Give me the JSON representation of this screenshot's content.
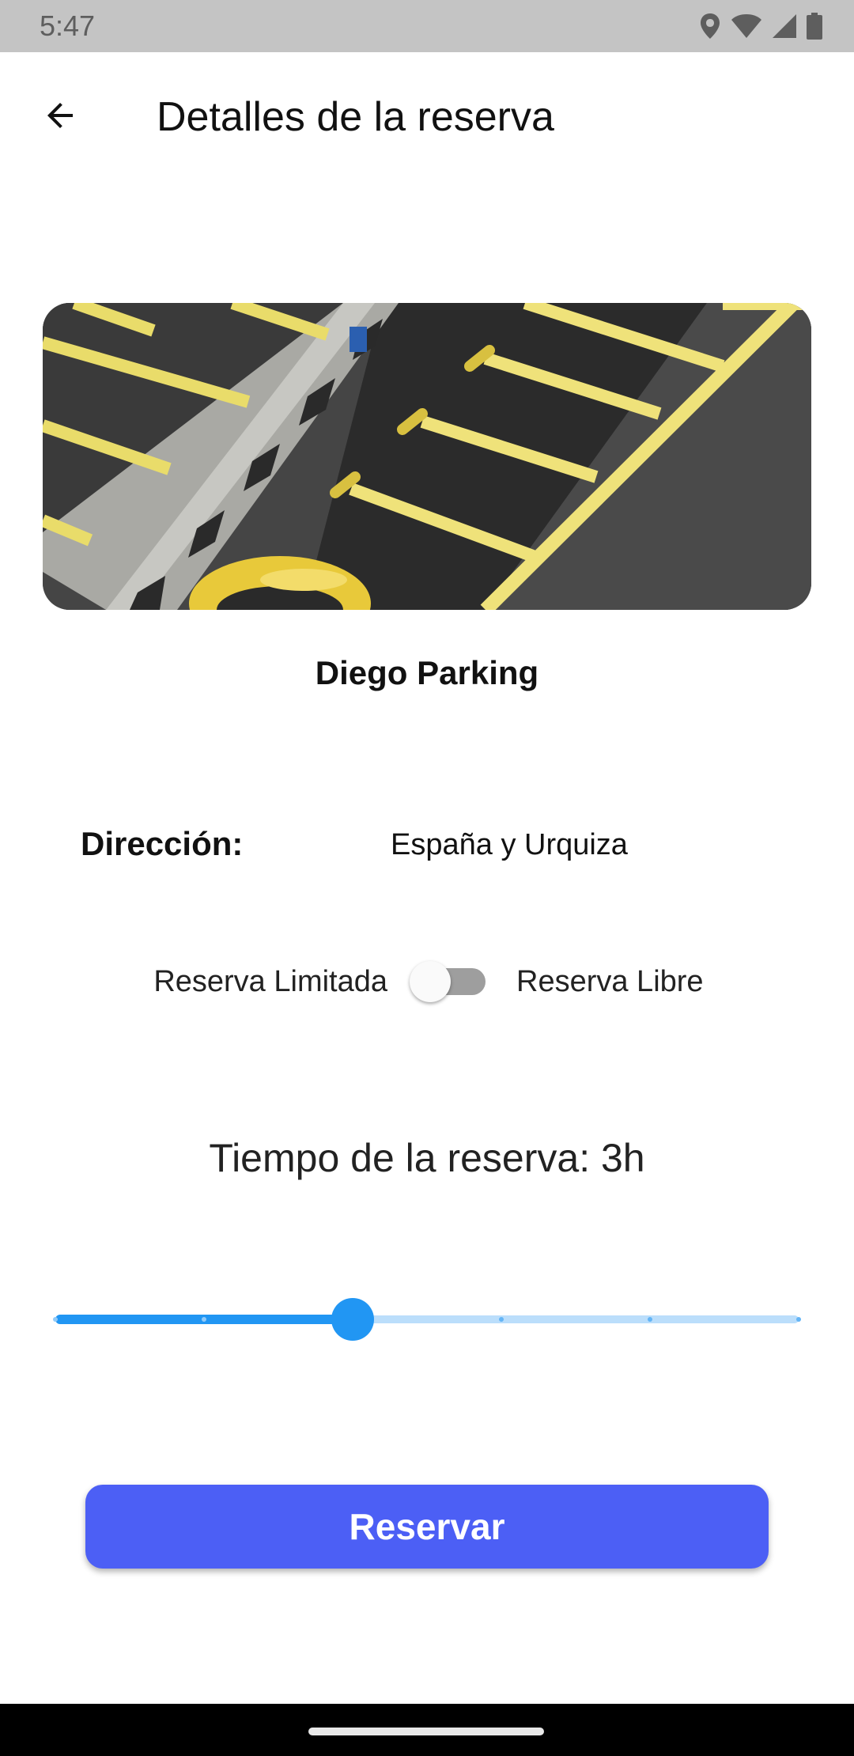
{
  "status_bar": {
    "time": "5:47",
    "icons": [
      "location-icon",
      "wifi-icon",
      "cellular-signal-icon",
      "battery-icon"
    ]
  },
  "app_bar": {
    "back_icon": "arrow-left-icon",
    "title": "Detalles de la reserva"
  },
  "parking": {
    "image": "parking-lot-photo",
    "name": "Diego Parking",
    "address_label": "Dirección:",
    "address_value": "España y Urquiza"
  },
  "reservation_type": {
    "left_label": "Reserva Limitada",
    "right_label": "Reserva Libre",
    "is_on": false
  },
  "duration": {
    "label": "Tiempo de la reserva: 3h",
    "slider_value": 3,
    "slider_min": 1,
    "slider_max": 6,
    "slider_divisions": 5
  },
  "actions": {
    "reserve_label": "Reservar"
  },
  "colors": {
    "accent": "#2196f3",
    "accent_light": "#bbdefb",
    "button": "#4c5ff5",
    "status_bar": "#c4c4c4"
  }
}
